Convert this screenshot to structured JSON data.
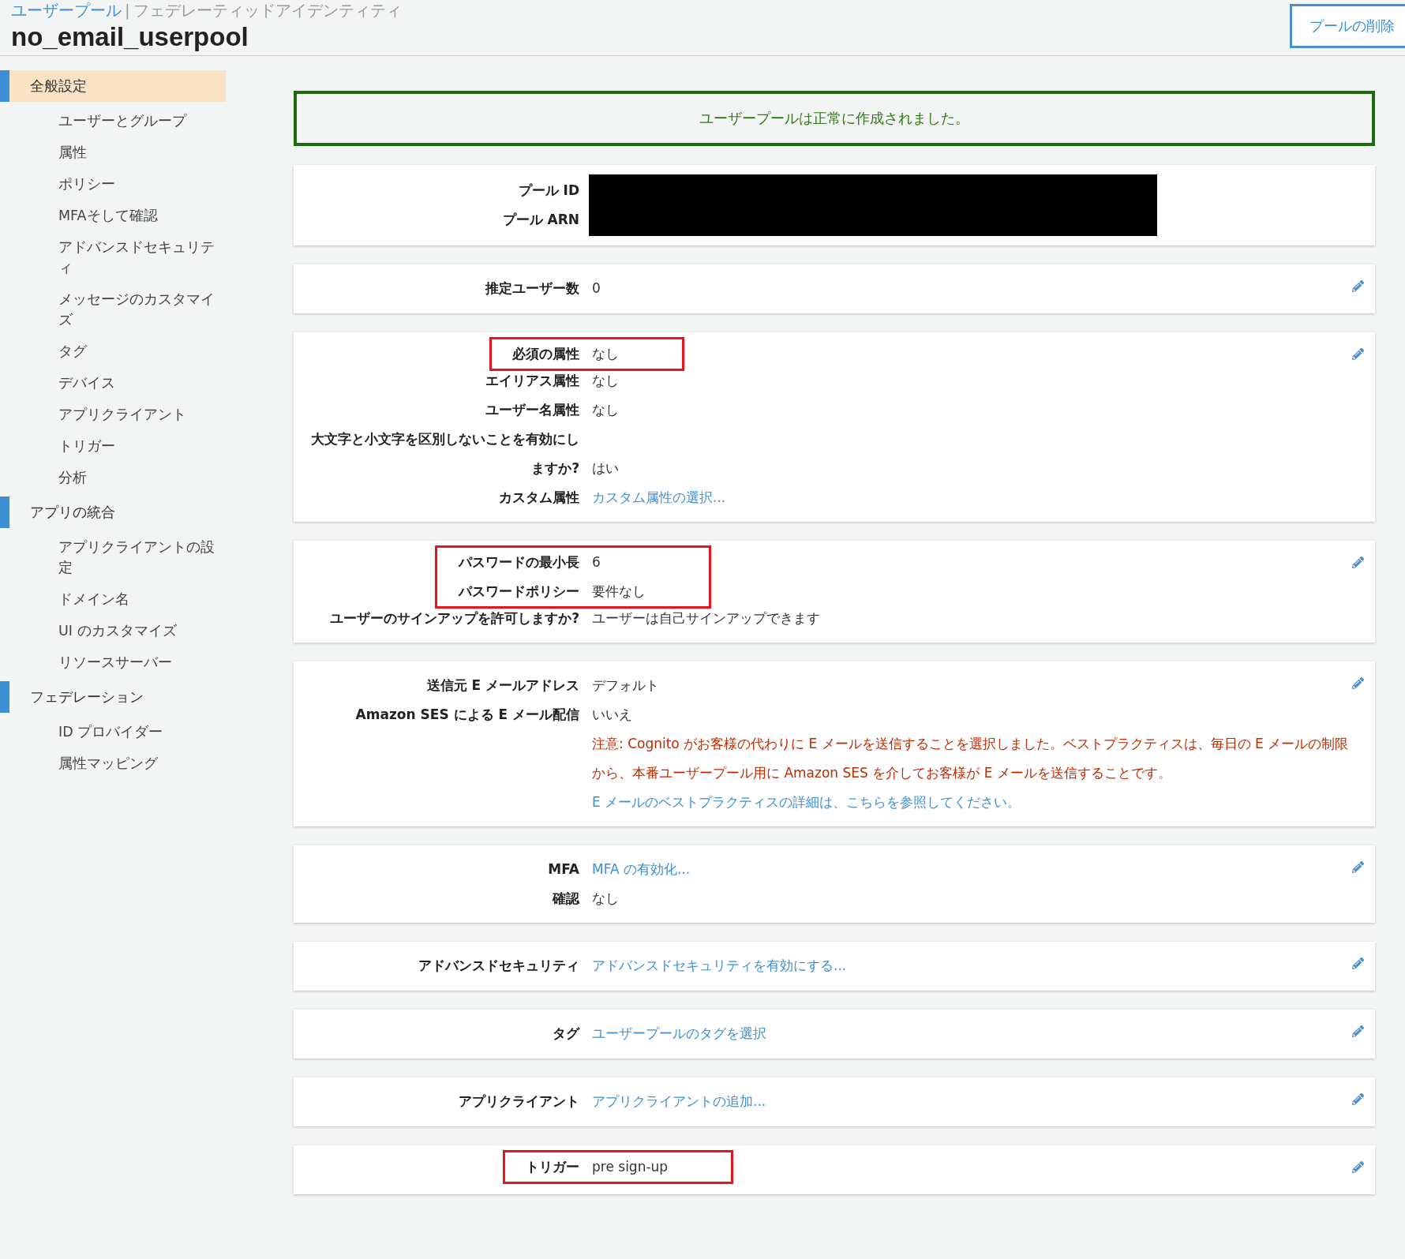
{
  "header": {
    "breadcrumb": {
      "link": "ユーザープール",
      "separator": "|",
      "current": "フェデレーティッドアイデンティティ"
    },
    "title": "no_email_userpool",
    "delete_button": "プールの削除"
  },
  "sidebar": {
    "sections": [
      {
        "label": "全般設定",
        "selected": true,
        "children": [
          {
            "label": "ユーザーとグループ",
            "selected": false
          },
          {
            "label": "属性",
            "selected": false
          },
          {
            "label": "ポリシー",
            "selected": false
          },
          {
            "label": "MFAそして確認",
            "selected": false
          },
          {
            "label": "アドバンスドセキュリティ",
            "selected": false
          },
          {
            "label": "メッセージのカスタマイズ",
            "selected": false
          },
          {
            "label": "タグ",
            "selected": false
          },
          {
            "label": "デバイス",
            "selected": false
          },
          {
            "label": "アプリクライアント",
            "selected": false
          },
          {
            "label": "トリガー",
            "selected": false
          },
          {
            "label": "分析",
            "selected": false
          }
        ]
      },
      {
        "label": "アプリの統合",
        "selected": false,
        "children": [
          {
            "label": "アプリクライアントの設定",
            "selected": false
          },
          {
            "label": "ドメイン名",
            "selected": false
          },
          {
            "label": "UI のカスタマイズ",
            "selected": false
          },
          {
            "label": "リソースサーバー",
            "selected": false
          }
        ]
      },
      {
        "label": "フェデレーション",
        "selected": false,
        "children": [
          {
            "label": "ID プロバイダー",
            "selected": false
          },
          {
            "label": "属性マッピング",
            "selected": false
          }
        ]
      }
    ]
  },
  "banner": {
    "message": "ユーザープールは正常に作成されました。"
  },
  "cards": [
    {
      "kind": "redacted",
      "editable": false,
      "labels": [
        "プール ID",
        "プール ARN"
      ]
    },
    {
      "kind": "rows",
      "editable": true,
      "groups": [
        {
          "highlighted": false,
          "rows": [
            {
              "kind": "field",
              "label": "推定ユーザー数",
              "value": "0",
              "link": false
            }
          ]
        }
      ]
    },
    {
      "kind": "rows",
      "editable": true,
      "groups": [
        {
          "highlighted": true,
          "rows": [
            {
              "kind": "field",
              "label": "必須の属性",
              "value": "なし",
              "link": false
            }
          ]
        },
        {
          "highlighted": false,
          "rows": [
            {
              "kind": "field",
              "label": "エイリアス属性",
              "value": "なし",
              "link": false
            },
            {
              "kind": "field",
              "label": "ユーザー名属性",
              "value": "なし",
              "link": false
            },
            {
              "kind": "field",
              "label": "大文字と小文字を区別しないことを有効にしますか?",
              "value": "はい",
              "link": false
            },
            {
              "kind": "field",
              "label": "カスタム属性",
              "value": "カスタム属性の選択...",
              "link": true
            }
          ]
        }
      ]
    },
    {
      "kind": "rows",
      "editable": true,
      "groups": [
        {
          "highlighted": true,
          "rows": [
            {
              "kind": "field",
              "label": "パスワードの最小長",
              "value": "6",
              "link": false
            },
            {
              "kind": "field",
              "label": "パスワードポリシー",
              "value": "要件なし",
              "link": false
            }
          ]
        },
        {
          "highlighted": false,
          "rows": [
            {
              "kind": "field",
              "label": "ユーザーのサインアップを許可しますか?",
              "value": "ユーザーは自己サインアップできます",
              "link": false
            }
          ]
        }
      ]
    },
    {
      "kind": "rows",
      "editable": true,
      "groups": [
        {
          "highlighted": false,
          "rows": [
            {
              "kind": "field",
              "label": "送信元 E メールアドレス",
              "value": "デフォルト",
              "link": false
            },
            {
              "kind": "field",
              "label": "Amazon SES による E メール配信",
              "value": "いいえ",
              "link": false
            },
            {
              "kind": "notice",
              "text": "注意: Cognito がお客様の代わりに E メールを送信することを選択しました。ベストプラクティスは、毎日の E メールの制限から、本番ユーザープール用に Amazon SES を介してお客様が E メールを送信することです。",
              "link": "E メールのベストプラクティスの詳細は、こちらを参照してください。"
            }
          ]
        }
      ]
    },
    {
      "kind": "rows",
      "editable": true,
      "groups": [
        {
          "highlighted": false,
          "rows": [
            {
              "kind": "field",
              "label": "MFA",
              "value": "MFA の有効化...",
              "link": true
            },
            {
              "kind": "field",
              "label": "確認",
              "value": "なし",
              "link": false
            }
          ]
        }
      ]
    },
    {
      "kind": "rows",
      "editable": true,
      "groups": [
        {
          "highlighted": false,
          "rows": [
            {
              "kind": "field",
              "label": "アドバンスドセキュリティ",
              "value": "アドバンスドセキュリティを有効にする...",
              "link": true
            }
          ]
        }
      ]
    },
    {
      "kind": "rows",
      "editable": true,
      "groups": [
        {
          "highlighted": false,
          "rows": [
            {
              "kind": "field",
              "label": "タグ",
              "value": "ユーザープールのタグを選択",
              "link": true
            }
          ]
        }
      ]
    },
    {
      "kind": "rows",
      "editable": true,
      "groups": [
        {
          "highlighted": false,
          "rows": [
            {
              "kind": "field",
              "label": "アプリクライアント",
              "value": "アプリクライアントの追加...",
              "link": true
            }
          ]
        }
      ]
    },
    {
      "kind": "rows",
      "editable": true,
      "groups": [
        {
          "highlighted": true,
          "rows": [
            {
              "kind": "field",
              "label": "トリガー",
              "value": "pre sign-up",
              "link": false
            }
          ]
        }
      ]
    }
  ]
}
